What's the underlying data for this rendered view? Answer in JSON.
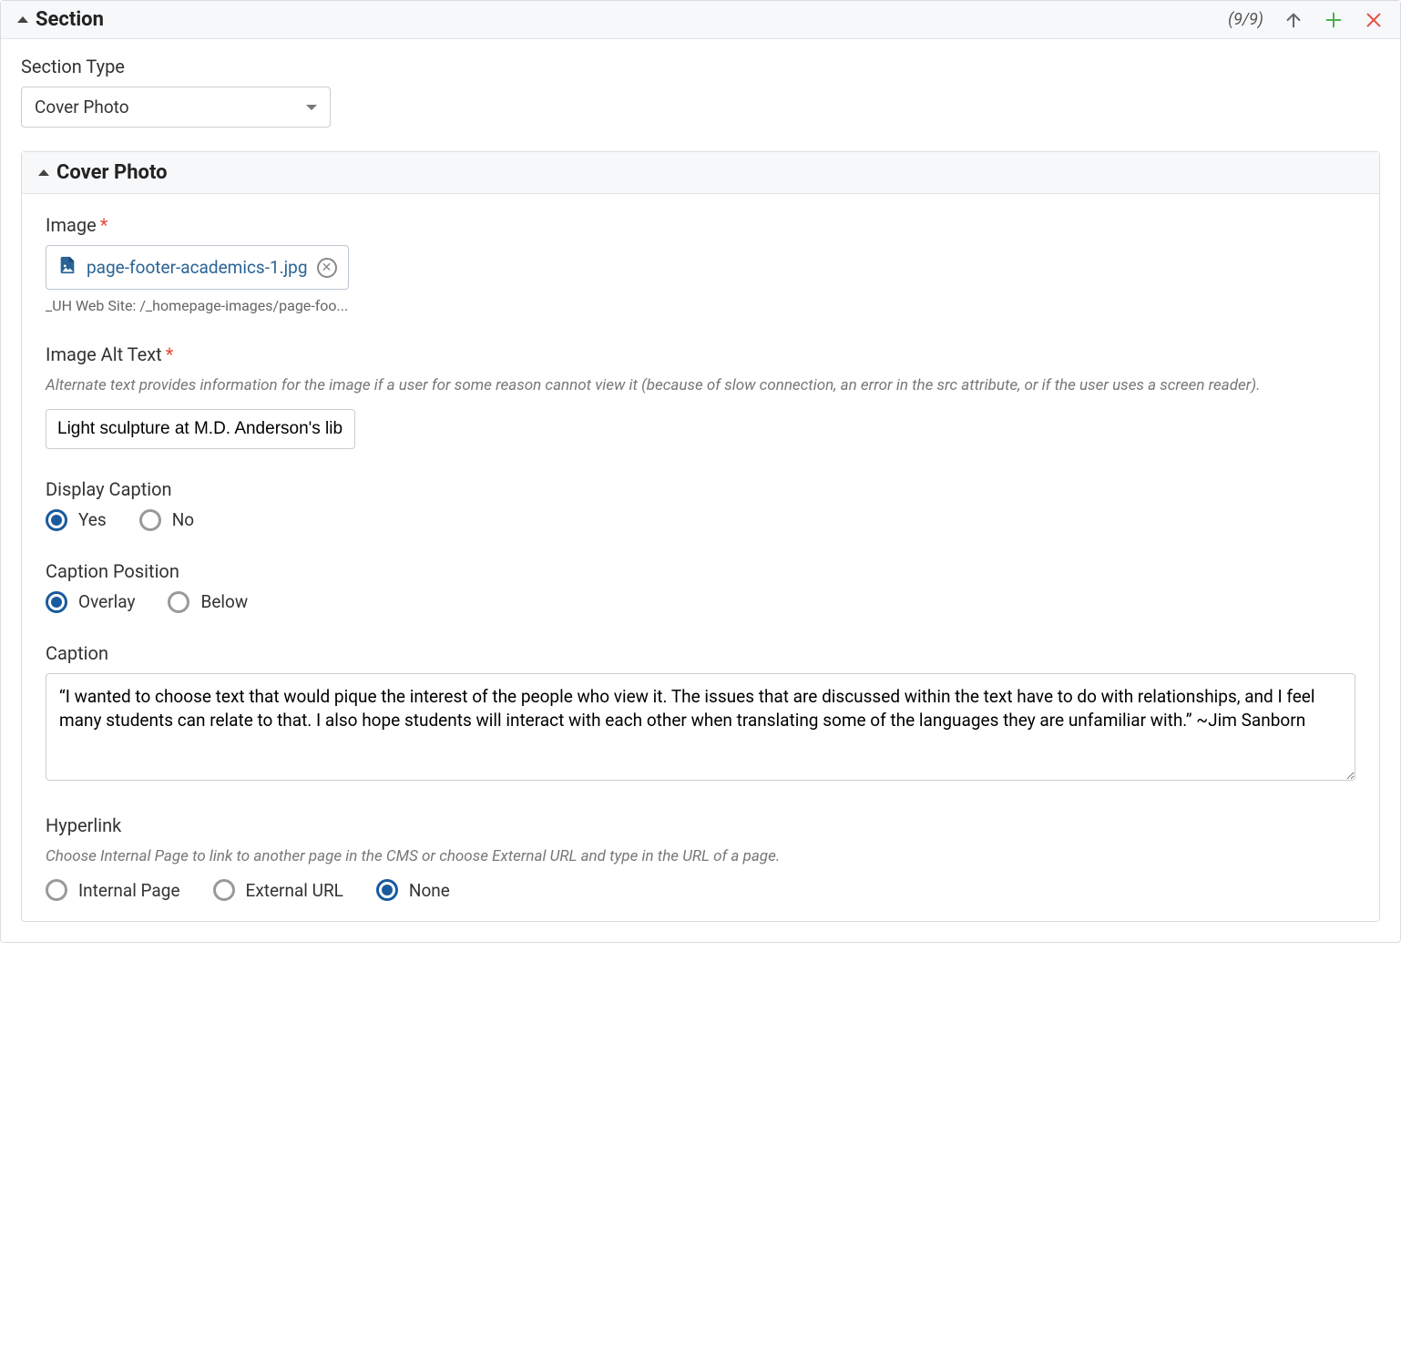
{
  "section": {
    "header_title": "Section",
    "counter": "(9/9)"
  },
  "section_type": {
    "label": "Section Type",
    "value": "Cover Photo"
  },
  "cover_photo": {
    "header_title": "Cover Photo",
    "image": {
      "label": "Image",
      "filename": "page-footer-academics-1.jpg",
      "path": "_UH Web Site: /_homepage-images/page-foo..."
    },
    "alt_text": {
      "label": "Image Alt Text",
      "help": "Alternate text provides information for the image if a user for some reason cannot view it (because of slow connection, an error in the src attribute, or if the user uses a screen reader).",
      "value": "Light sculpture at M.D. Anderson's lib"
    },
    "display_caption": {
      "label": "Display Caption",
      "options": [
        "Yes",
        "No"
      ],
      "selected": "Yes"
    },
    "caption_position": {
      "label": "Caption Position",
      "options": [
        "Overlay",
        "Below"
      ],
      "selected": "Overlay"
    },
    "caption": {
      "label": "Caption",
      "value": "“I wanted to choose text that would pique the interest of the people who view it. The issues that are discussed within the text have to do with relationships, and I feel many students can relate to that. I also hope students will interact with each other when translating some of the languages they are unfamiliar with.” ~Jim Sanborn"
    },
    "hyperlink": {
      "label": "Hyperlink",
      "help": "Choose Internal Page to link to another page in the CMS or choose External URL and type in the URL of a page.",
      "options": [
        "Internal Page",
        "External URL",
        "None"
      ],
      "selected": "None"
    }
  }
}
